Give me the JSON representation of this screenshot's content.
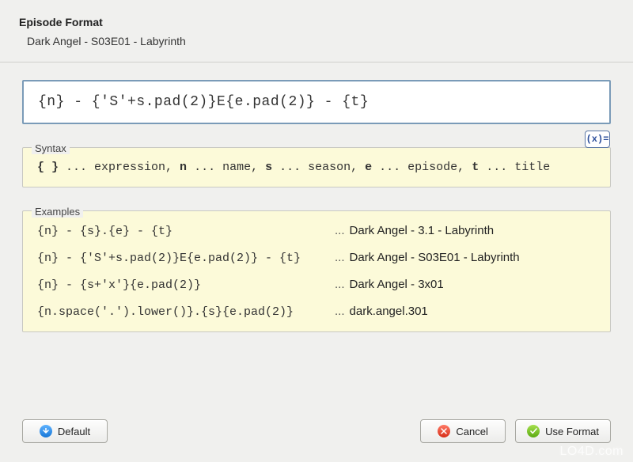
{
  "header": {
    "title": "Episode Format",
    "sample": "Dark Angel - S03E01 - Labyrinth"
  },
  "format_value": "{n} - {'S'+s.pad(2)}E{e.pad(2)} - {t}",
  "syntax": {
    "label": "Syntax",
    "braces": "{ }",
    "text_expr": " ... expression, ",
    "n": "n",
    "text_name": " ... name, ",
    "s": "s",
    "text_season": " ... season, ",
    "e": "e",
    "text_episode": " ... episode, ",
    "t": "t",
    "text_title": " ... title"
  },
  "fx_label": "(x)=",
  "examples": {
    "label": "Examples",
    "rows": [
      {
        "code": "{n} - {s}.{e} - {t}",
        "dots": "...",
        "result": "Dark Angel - 3.1 - Labyrinth"
      },
      {
        "code": "{n} - {'S'+s.pad(2)}E{e.pad(2)} - {t}",
        "dots": "...",
        "result": "Dark Angel - S03E01 - Labyrinth"
      },
      {
        "code": "{n} - {s+'x'}{e.pad(2)}",
        "dots": "...",
        "result": "Dark Angel - 3x01"
      },
      {
        "code": "{n.space('.').lower()}.{s}{e.pad(2)}",
        "dots": "...",
        "result": "dark.angel.301"
      }
    ]
  },
  "buttons": {
    "default": "Default",
    "cancel": "Cancel",
    "use_format": "Use Format"
  },
  "watermark": "LO4D.com"
}
